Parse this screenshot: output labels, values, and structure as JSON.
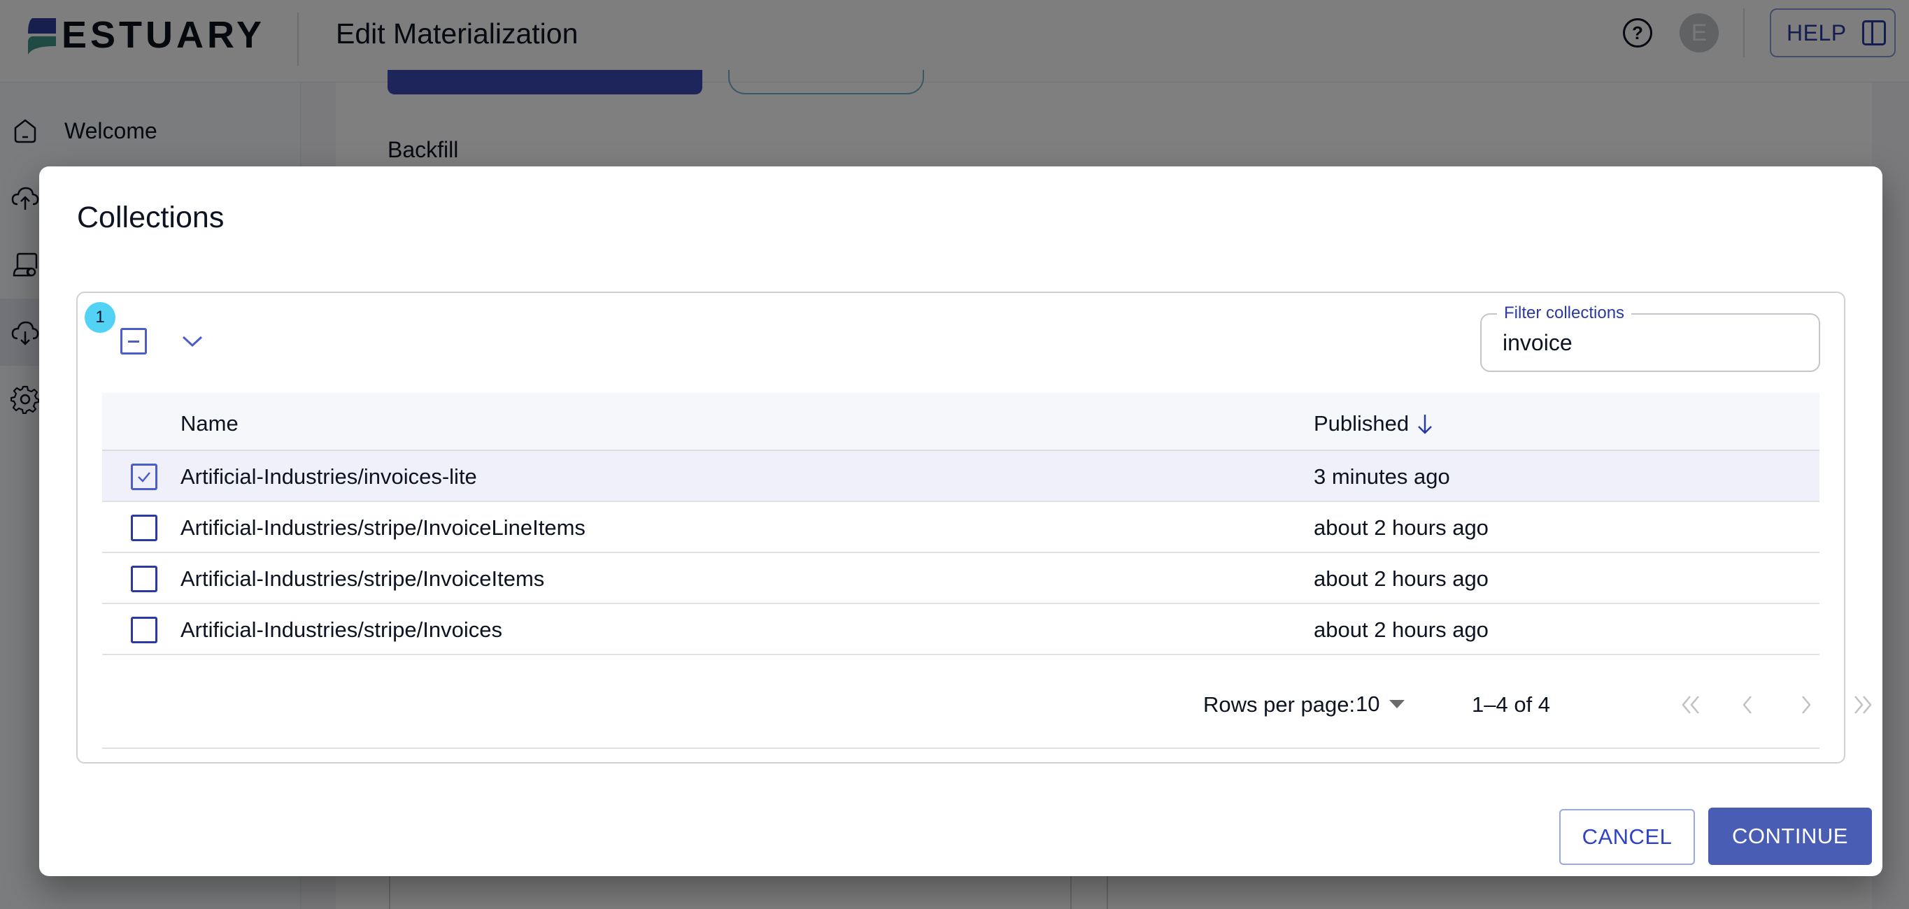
{
  "app": {
    "logo_text": "ESTUARY",
    "page_title": "Edit Materialization",
    "avatar_initial": "E",
    "help_button": "HELP",
    "colors": {
      "primary": "#4a5db5",
      "primary_dark": "#2a3aa0",
      "badge": "#52d3f5",
      "selected_row": "#eff0f9"
    }
  },
  "sidebar": {
    "items": [
      {
        "label": "Welcome",
        "icon": "home-icon"
      },
      {
        "label": "",
        "icon": "cloud-upload-icon"
      },
      {
        "label": "",
        "icon": "collections-icon"
      },
      {
        "label": "",
        "icon": "cloud-download-icon"
      },
      {
        "label": "",
        "icon": "gear-icon"
      }
    ]
  },
  "background": {
    "section_label": "Backfill"
  },
  "modal": {
    "title": "Collections",
    "selected_count": "1",
    "filter": {
      "label": "Filter collections",
      "value": "invoice"
    },
    "table": {
      "columns": [
        "Name",
        "Published"
      ],
      "sort_column": "Published",
      "sort_direction": "descending",
      "rows": [
        {
          "name": "Artificial-Industries/invoices-lite",
          "published": "3 minutes ago",
          "selected": true
        },
        {
          "name": "Artificial-Industries/stripe/InvoiceLineItems",
          "published": "about 2 hours ago",
          "selected": false
        },
        {
          "name": "Artificial-Industries/stripe/InvoiceItems",
          "published": "about 2 hours ago",
          "selected": false
        },
        {
          "name": "Artificial-Industries/stripe/Invoices",
          "published": "about 2 hours ago",
          "selected": false
        }
      ]
    },
    "pagination": {
      "rows_per_page_label": "Rows per page:",
      "rows_per_page": "10",
      "range": "1–4 of 4"
    },
    "buttons": {
      "cancel": "CANCEL",
      "continue": "CONTINUE"
    }
  }
}
